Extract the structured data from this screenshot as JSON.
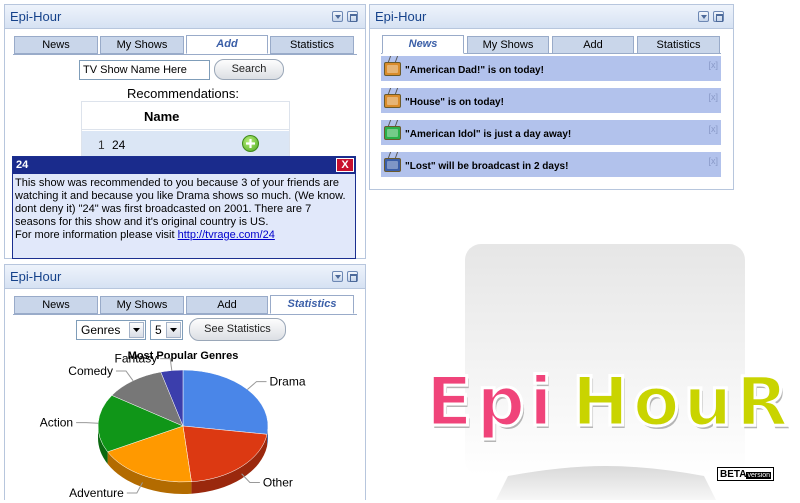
{
  "widgets": {
    "add": {
      "title": "Epi-Hour",
      "tabs": [
        "News",
        "My Shows",
        "Add",
        "Statistics"
      ],
      "active_tab": "Add",
      "search": {
        "value": "TV Show Name Here",
        "button": "Search"
      },
      "recommendations_label": "Recommendations:",
      "table": {
        "header": "Name",
        "rows": [
          {
            "index": "1",
            "name": "24"
          }
        ]
      }
    },
    "popup": {
      "title": "24",
      "close": "X",
      "body": "This show was recommended to you because 3 of your friends are watching it and because you like Drama shows so much. (We know. dont deny it) \"24\" was first broadcasted on 2001. There are 7 seasons for this show and it's original country is US.",
      "more_text": "For more information please visit ",
      "link": "http://tvrage.com/24"
    },
    "news": {
      "title": "Epi-Hour",
      "tabs": [
        "News",
        "My Shows",
        "Add",
        "Statistics"
      ],
      "active_tab": "News",
      "items": [
        {
          "text": "\"American Dad!\" is on today!",
          "tv_color": "#d98c2b",
          "dismiss": "[x]"
        },
        {
          "text": "\"House\" is on today!",
          "tv_color": "#d98c2b",
          "dismiss": "[x]"
        },
        {
          "text": "\"American Idol\" is just a day away!",
          "tv_color": "#2bb04a",
          "dismiss": "[x]"
        },
        {
          "text": "\"Lost\" will be broadcast in 2 days!",
          "tv_color": "#3b5ea8",
          "dismiss": "[x]"
        }
      ]
    },
    "stats": {
      "title": "Epi-Hour",
      "tabs": [
        "News",
        "My Shows",
        "Add",
        "Statistics"
      ],
      "active_tab": "Statistics",
      "type_select": "Genres",
      "count_select": "5",
      "button": "See Statistics",
      "chart_title": "Most Popular Genres"
    }
  },
  "logo": {
    "text_epi": "Epi",
    "text_hour": "HouR",
    "badge_strong": "BETA",
    "badge_small": "version"
  },
  "chart_data": {
    "type": "pie",
    "title": "Most Popular Genres",
    "categories": [
      "Drama",
      "Other",
      "Adventure",
      "Action",
      "Comedy",
      "Fantasy"
    ],
    "values": [
      26,
      20,
      18,
      16,
      11,
      4
    ],
    "colors": [
      "#4a86e8",
      "#dc3912",
      "#ff9900",
      "#109618",
      "#777777",
      "#3b3eac"
    ]
  },
  "colors": {
    "header_text": "#15428b",
    "popup_head": "#1a2b8c",
    "news_item": "#b2c2ec"
  }
}
